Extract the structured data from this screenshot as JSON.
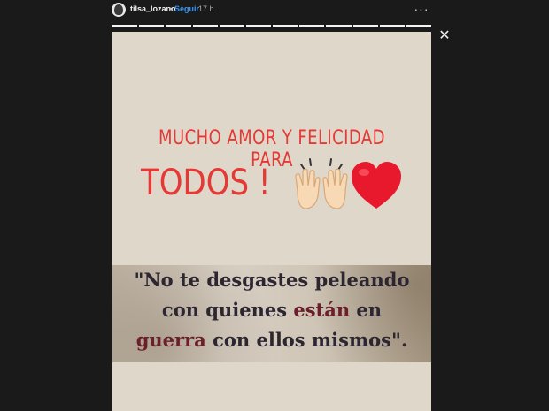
{
  "header": {
    "username": "tilsa_lozano",
    "separator": "•",
    "follow_label": "Seguir",
    "time": "17 h",
    "more_label": "···",
    "close_label": "✕"
  },
  "progress": {
    "segments": 12,
    "completed": 12
  },
  "story": {
    "headline_line1": "MUCHO AMOR Y FELICIDAD PARA",
    "headline_line2": "TODOS !",
    "emoji_hands": "raised-hands",
    "emoji_heart": "red-heart",
    "quote_line1": "\"No te desgastes peleando",
    "quote_line2_a": "con quienes ",
    "quote_line2_b": "están",
    "quote_line2_c": " en",
    "quote_line3_a": "guerra",
    "quote_line3_b": " con ellos mismos\"."
  },
  "colors": {
    "headline": "#e53935",
    "story_bg": "#e0d7cb",
    "follow": "#3897f0",
    "quote_text": "#2b2630",
    "quote_accent": "#6b1f2a"
  }
}
